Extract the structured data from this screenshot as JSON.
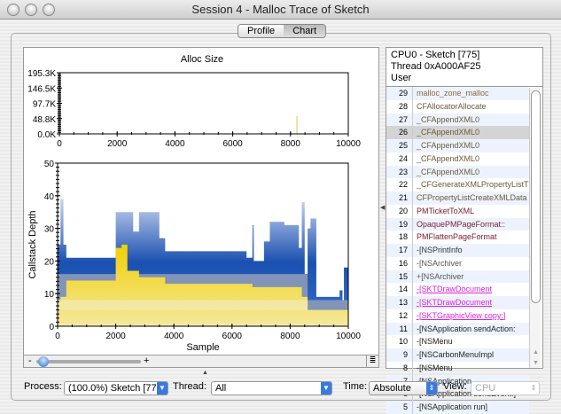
{
  "window": {
    "title": "Session 4 - Malloc Trace of Sketch"
  },
  "tabs": [
    {
      "label": "Profile",
      "selected": false
    },
    {
      "label": "Chart",
      "selected": true
    }
  ],
  "chart_data": [
    {
      "type": "bar",
      "title": "Alloc Size",
      "xlim": [
        0,
        10000
      ],
      "ylim": [
        0,
        195300
      ],
      "yticks": [
        "195.3K",
        "146.5K",
        "97.7K",
        "48.8K",
        "0.0K"
      ],
      "xticks": [
        "0",
        "2000",
        "4000",
        "6000",
        "8000",
        "10000"
      ],
      "x": [
        8200
      ],
      "values": [
        57000
      ],
      "color": "#f5d58a"
    },
    {
      "type": "area",
      "xlabel": "Sample",
      "ylabel": "Callstack Depth",
      "xlim": [
        0,
        10000
      ],
      "ylim": [
        0,
        50
      ],
      "yticks": [
        "50",
        "40",
        "30",
        "20",
        "10",
        "0"
      ],
      "xticks": [
        "0",
        "2000",
        "4000",
        "6000",
        "8000",
        "10000"
      ],
      "series": [
        {
          "role": "max_depth",
          "color": "#1a50b0",
          "steps": [
            [
              0,
              25
            ],
            [
              100,
              39
            ],
            [
              200,
              25
            ],
            [
              300,
              21
            ],
            [
              2000,
              35
            ],
            [
              2600,
              29
            ],
            [
              2800,
              35
            ],
            [
              3500,
              27
            ],
            [
              3700,
              23
            ],
            [
              6500,
              21
            ],
            [
              6700,
              31
            ],
            [
              6750,
              20
            ],
            [
              7100,
              26
            ],
            [
              7300,
              32
            ],
            [
              7800,
              31
            ],
            [
              8300,
              24
            ],
            [
              8400,
              38
            ],
            [
              8500,
              16
            ],
            [
              8600,
              30
            ],
            [
              8700,
              33
            ],
            [
              8900,
              9
            ],
            [
              9700,
              11
            ],
            [
              9800,
              8
            ],
            [
              9850,
              18
            ],
            [
              10000,
              18
            ]
          ]
        },
        {
          "role": "base_depth",
          "color": "#8c9ab8",
          "steps": [
            [
              0,
              16
            ],
            [
              8600,
              8
            ],
            [
              10000,
              8
            ]
          ]
        },
        {
          "role": "selected_depth",
          "color": "#e8c800",
          "steps": [
            [
              0,
              8
            ],
            [
              100,
              9
            ],
            [
              300,
              14
            ],
            [
              2000,
              24
            ],
            [
              2200,
              25
            ],
            [
              2400,
              17
            ],
            [
              2800,
              15
            ],
            [
              3700,
              13
            ],
            [
              6700,
              12
            ],
            [
              8400,
              9
            ],
            [
              8600,
              5
            ],
            [
              10000,
              5
            ]
          ]
        }
      ]
    }
  ],
  "slider": {
    "minus": "-",
    "plus": "+",
    "value": 0.1
  },
  "stack": {
    "header": [
      "CPU0 - Sketch [775]",
      "Thread 0xA000AF25",
      "User"
    ],
    "rows": [
      {
        "n": "29",
        "f": "malloc_zone_malloc",
        "c": "#8a6a3a"
      },
      {
        "n": "28",
        "f": "CFAllocatorAllocate",
        "c": "#6a5a3a"
      },
      {
        "n": "27",
        "f": "_CFAppendXML0",
        "c": "#6a5a3a"
      },
      {
        "n": "26",
        "f": "_CFAppendXML0",
        "c": "#6a5a3a",
        "sel": true
      },
      {
        "n": "25",
        "f": "_CFAppendXML0",
        "c": "#6a5a3a"
      },
      {
        "n": "24",
        "f": "_CFAppendXML0",
        "c": "#6a5a3a"
      },
      {
        "n": "23",
        "f": "_CFAppendXML0",
        "c": "#6a5a3a"
      },
      {
        "n": "22",
        "f": "_CFGenerateXMLPropertyListT",
        "c": "#6a5a3a"
      },
      {
        "n": "21",
        "f": "CFPropertyListCreateXMLData",
        "c": "#6a5a3a"
      },
      {
        "n": "20",
        "f": "PMTicketToXML",
        "c": "#7a2030"
      },
      {
        "n": "19",
        "f": "OpaquePMPageFormat::",
        "c": "#7a2030"
      },
      {
        "n": "18",
        "f": "PMFlattenPageFormat",
        "c": "#7a2030"
      },
      {
        "n": "17",
        "f": "-[NSPrintInfo",
        "c": "#333"
      },
      {
        "n": "16",
        "f": "-[NSArchiver",
        "c": "#555"
      },
      {
        "n": "15",
        "f": "+[NSArchiver",
        "c": "#555"
      },
      {
        "n": "14",
        "f": "-[SKTDrawDocument",
        "c": "#e020e0",
        "u": true
      },
      {
        "n": "13",
        "f": "-[SKTDrawDocument",
        "c": "#e020e0",
        "u": true
      },
      {
        "n": "12",
        "f": "-[SKTGraphicView copy:]",
        "c": "#e020e0",
        "u": true
      },
      {
        "n": "11",
        "f": "-[NSApplication sendAction:",
        "c": "#222"
      },
      {
        "n": "10",
        "f": "-[NSMenu",
        "c": "#222"
      },
      {
        "n": "9",
        "f": "-[NSCarbonMenuImpl",
        "c": "#222"
      },
      {
        "n": "8",
        "f": "-[NSMenu",
        "c": "#222"
      },
      {
        "n": "7",
        "f": "-[NSApplication",
        "c": "#222"
      },
      {
        "n": "6",
        "f": "-[NSApplication sendEvent:]",
        "c": "#222"
      },
      {
        "n": "5",
        "f": "-[NSApplication run]",
        "c": "#222"
      }
    ]
  },
  "bottom": {
    "process_label": "Process:",
    "process_value": "(100.0%) Sketch [775]",
    "thread_label": "Thread:",
    "thread_value": "All",
    "time_label": "Time:",
    "time_value": "Absolute",
    "view_label": "View:",
    "view_value": "CPU"
  }
}
